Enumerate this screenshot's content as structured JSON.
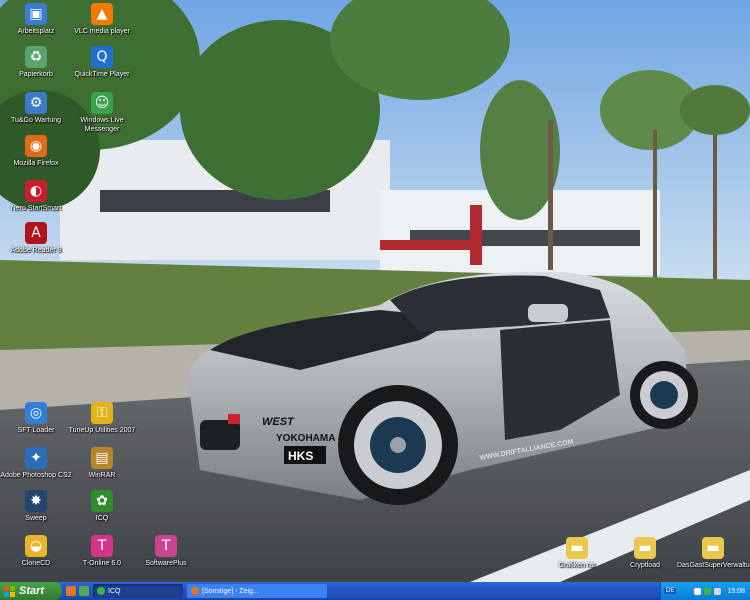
{
  "desktop": {
    "icons": [
      {
        "label": "Arbeitsplatz",
        "icon": "computer-icon",
        "color": "#3a7bd5",
        "glyph": "▣"
      },
      {
        "label": "VLC media player",
        "icon": "vlc-cone-icon",
        "color": "#f07b00",
        "glyph": "▲"
      },
      {
        "label": "Papierkorb",
        "icon": "recycle-bin-icon",
        "color": "#5aa36b",
        "glyph": "♻"
      },
      {
        "label": "QuickTime Player",
        "icon": "quicktime-icon",
        "color": "#1f6fd1",
        "glyph": "Q"
      },
      {
        "label": "Tu&Go Wartung",
        "icon": "maintenance-icon",
        "color": "#3b79c9",
        "glyph": "⚙"
      },
      {
        "label": "Windows Live Messenger",
        "icon": "messenger-icon",
        "color": "#39a24a",
        "glyph": "☺"
      },
      {
        "label": "Mozilla Firefox",
        "icon": "firefox-icon",
        "color": "#e06a1b",
        "glyph": "◉"
      },
      {
        "label": "Nero StartSmart",
        "icon": "nero-icon",
        "color": "#c71f2b",
        "glyph": "◐"
      },
      {
        "label": "Adobe Reader 8",
        "icon": "adobe-reader-icon",
        "color": "#b3121b",
        "glyph": "A"
      },
      {
        "label": "SFT Loader",
        "icon": "loader-globe-icon",
        "color": "#2f7fd8",
        "glyph": "◎"
      },
      {
        "label": "TuneUp Utilities 2007",
        "icon": "tuneup-key-icon",
        "color": "#e2b21a",
        "glyph": "⚿"
      },
      {
        "label": "Adobe Photoshop CS2",
        "icon": "photoshop-icon",
        "color": "#2c6bb6",
        "glyph": "✦"
      },
      {
        "label": "WinRAR",
        "icon": "winrar-icon",
        "color": "#b8862a",
        "glyph": "▤"
      },
      {
        "label": "Sweep",
        "icon": "sweep-icon",
        "color": "#24466e",
        "glyph": "✸"
      },
      {
        "label": "ICQ",
        "icon": "icq-flower-icon",
        "color": "#2e8b2e",
        "glyph": "✿"
      },
      {
        "label": "CloneCD",
        "icon": "clonecd-icon",
        "color": "#e8b52a",
        "glyph": "◒"
      },
      {
        "label": "T-Online 6.0",
        "icon": "t-online-icon",
        "color": "#d6338b",
        "glyph": "T"
      },
      {
        "label": "SoftwarePlus",
        "icon": "softwareplus-icon",
        "color": "#c9458f",
        "glyph": "T"
      },
      {
        "label": "Grafiken rar",
        "icon": "folder-icon",
        "color": "#e9c84d",
        "glyph": "▬"
      },
      {
        "label": "Cryptload",
        "icon": "folder-icon",
        "color": "#e9c84d",
        "glyph": "▬"
      },
      {
        "label": "DasGastSuperVerwaltu...",
        "icon": "folder-icon",
        "color": "#e9c84d",
        "glyph": "▬"
      }
    ]
  },
  "car_decals": {
    "west": "WEST",
    "yokohama": "YOKOHAMA",
    "hks": "HKS",
    "side": "WWW.DRIFTALLIANCE.COM"
  },
  "taskbar": {
    "start_label": "Start",
    "tasks": [
      {
        "label": "ICQ",
        "icon": "icq-flower-icon"
      },
      {
        "label": "[Sonstige] - Zeig...",
        "icon": "firefox-icon"
      }
    ],
    "language": "DE",
    "clock": "15:08"
  },
  "colors": {
    "taskbar_blue": "#2458c8",
    "start_green": "#3c8f3c",
    "tray_blue": "#0c7bd6"
  }
}
